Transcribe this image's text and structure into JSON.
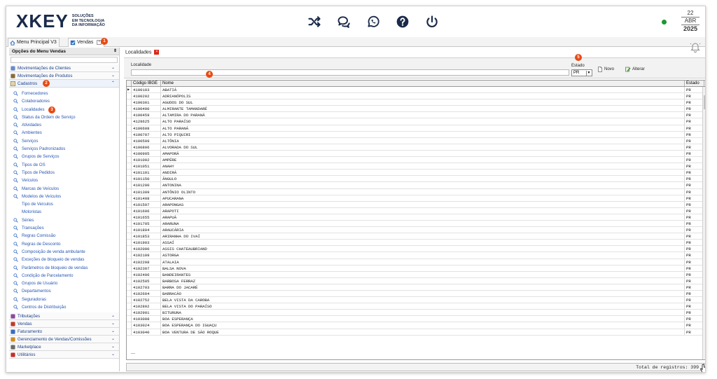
{
  "header": {
    "logo_word": "XKEY",
    "logo_sub": [
      "SOLUÇÕES",
      "EM TECNOLOGIA",
      "DA INFORMAÇÃO"
    ],
    "date_day": "22",
    "date_month": "ABR",
    "date_year": "2025",
    "status_color": "#1a9a2a",
    "icons": [
      "shuffle-icon",
      "chat-icon",
      "whatsapp-icon",
      "help-icon",
      "power-icon"
    ]
  },
  "tabs": [
    {
      "label": "Menu Principal V3"
    },
    {
      "label": "Vendas"
    }
  ],
  "badges": {
    "tab": "1",
    "cadastros": "2",
    "localidades": "3",
    "localidade": "4",
    "estado": "5"
  },
  "sidebar": {
    "title": "Opções do Menu Vendas",
    "groups_top": [
      {
        "label": "Movimentações de Clientes"
      },
      {
        "label": "Movimentações de Produtos"
      }
    ],
    "cadastros": {
      "label": "Cadastros",
      "items": [
        {
          "label": "Fornecedores",
          "icon": true
        },
        {
          "label": "Colaboradores",
          "icon": true
        },
        {
          "label": "Localidades",
          "icon": true
        },
        {
          "label": "Status da Ordem de Serviço",
          "icon": true
        },
        {
          "label": "Atividades",
          "icon": true
        },
        {
          "label": "Ambientes",
          "icon": true
        },
        {
          "label": "Serviços",
          "icon": true
        },
        {
          "label": "Serviços Padronizados",
          "icon": true
        },
        {
          "label": "Grupos de Serviços",
          "icon": true
        },
        {
          "label": "Tipos de OS",
          "icon": true
        },
        {
          "label": "Tipos de Pedidos",
          "icon": true
        },
        {
          "label": "Veículos",
          "icon": true
        },
        {
          "label": "Marcas de Veículos",
          "icon": true
        },
        {
          "label": "Modelos de Veículos",
          "icon": true
        },
        {
          "label": "Tipo de Veículos",
          "icon": false
        },
        {
          "label": "Motoristas",
          "icon": false
        },
        {
          "label": "Séries",
          "icon": true
        },
        {
          "label": "Transações",
          "icon": true
        },
        {
          "label": "Regras Comissão",
          "icon": true
        },
        {
          "label": "Regras de Desconto",
          "icon": true
        },
        {
          "label": "Composição de venda ambulante",
          "icon": true
        },
        {
          "label": "Exceções de bloqueio de vendas",
          "icon": true
        },
        {
          "label": "Parâmetros de bloqueio de vendas",
          "icon": true
        },
        {
          "label": "Condição de Parcelamento",
          "icon": true
        },
        {
          "label": "Grupos de Usuário",
          "icon": true
        },
        {
          "label": "Departamentos",
          "icon": true
        },
        {
          "label": "Seguradoras",
          "icon": true
        },
        {
          "label": "Centros de Distribuição",
          "icon": true
        }
      ]
    },
    "groups_bottom": [
      {
        "label": "Tributações"
      },
      {
        "label": "Vendas"
      },
      {
        "label": "Faturamento"
      },
      {
        "label": "Gerenciamento de Vendas/Comissões"
      },
      {
        "label": "Marketplace"
      },
      {
        "label": "Utilitários"
      }
    ]
  },
  "main": {
    "tab_label": "Localidades",
    "filter": {
      "localidade_label": "Localidade",
      "localidade_value": "",
      "estado_label": "Estado",
      "estado_value": "PR",
      "btn_novo": "Novo",
      "btn_alterar": "Alterar"
    },
    "columns": [
      "Código IBGE",
      "Nome",
      "Estado"
    ],
    "rows": [
      [
        "4100103",
        "ABATIÁ",
        "PR"
      ],
      [
        "4100202",
        "ADRIANÓPOLIS",
        "PR"
      ],
      [
        "4100301",
        "AGUDOS DO SUL",
        "PR"
      ],
      [
        "4100400",
        "ALMIRANTE TAMANDARÉ",
        "PR"
      ],
      [
        "4100459",
        "ALTAMIRA DO PARANÁ",
        "PR"
      ],
      [
        "4128625",
        "ALTO PARAÍSO",
        "PR"
      ],
      [
        "4100608",
        "ALTO PARANÁ",
        "PR"
      ],
      [
        "4100707",
        "ALTO PIQUIRI",
        "PR"
      ],
      [
        "4100509",
        "ALTÔNIA",
        "PR"
      ],
      [
        "4100806",
        "ALVORADA DO SUL",
        "PR"
      ],
      [
        "4100905",
        "AMAPORÃ",
        "PR"
      ],
      [
        "4101002",
        "AMPÉRE",
        "PR"
      ],
      [
        "4101051",
        "ANAHY",
        "PR"
      ],
      [
        "4101101",
        "ANDIRÁ",
        "PR"
      ],
      [
        "4101150",
        "ÂNGULO",
        "PR"
      ],
      [
        "4101200",
        "ANTONINA",
        "PR"
      ],
      [
        "4101309",
        "ANTÔNIO OLINTO",
        "PR"
      ],
      [
        "4101408",
        "APUCARANA",
        "PR"
      ],
      [
        "4101507",
        "ARAPONGAS",
        "PR"
      ],
      [
        "4101606",
        "ARAPOTI",
        "PR"
      ],
      [
        "4101655",
        "ARAPUÃ",
        "PR"
      ],
      [
        "4101705",
        "ARARUNA",
        "PR"
      ],
      [
        "4101804",
        "ARAUCÁRIA",
        "PR"
      ],
      [
        "4101853",
        "ARIRANHA DO IVAÍ",
        "PR"
      ],
      [
        "4101903",
        "ASSAÍ",
        "PR"
      ],
      [
        "4102000",
        "ASSIS CHATEAUBRIAND",
        "PR"
      ],
      [
        "4102109",
        "ASTORGA",
        "PR"
      ],
      [
        "4102208",
        "ATALAIA",
        "PR"
      ],
      [
        "4102307",
        "BALSA NOVA",
        "PR"
      ],
      [
        "4102406",
        "BANDEIRANTES",
        "PR"
      ],
      [
        "4102505",
        "BARBOSA FERRAZ",
        "PR"
      ],
      [
        "4102703",
        "BARRA DO JACARÉ",
        "PR"
      ],
      [
        "4102604",
        "BARRACÃO",
        "PR"
      ],
      [
        "4102752",
        "BELA VISTA DA CAROBA",
        "PR"
      ],
      [
        "4102802",
        "BELA VISTA DO PARAÍSO",
        "PR"
      ],
      [
        "4102901",
        "BITURUNA",
        "PR"
      ],
      [
        "4103008",
        "BOA ESPERANÇA",
        "PR"
      ],
      [
        "4103024",
        "BOA ESPERANÇA DO IGUAÇU",
        "PR"
      ],
      [
        "4103040",
        "BOA VENTURA DE SÃO ROQUE",
        "PR"
      ]
    ],
    "new_row_marker": "—",
    "total_label": "Total de registros: 399"
  }
}
